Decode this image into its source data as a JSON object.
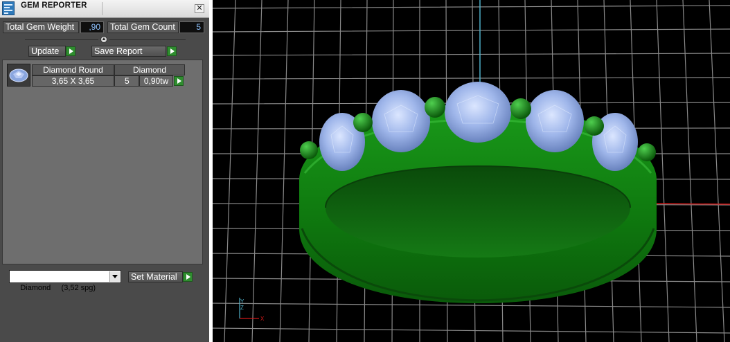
{
  "window": {
    "title": "GEM REPORTER",
    "close_glyph": "✕"
  },
  "summary": {
    "weight_label": "Total Gem Weight",
    "weight_value": ",90",
    "count_label": "Total Gem Count",
    "count_value": "5"
  },
  "actions": {
    "update_label": "Update",
    "save_label": "Save Report"
  },
  "table": {
    "headers": [
      "Diamond Round",
      "Diamond"
    ],
    "row": {
      "size": "3,65 X 3,65",
      "count": "5",
      "weight": "0,90tw"
    }
  },
  "material": {
    "selected": "Diamond     (3,52 spg)",
    "set_label": "Set Material"
  },
  "axis": {
    "y": "Y",
    "z": "Z",
    "x": "X"
  },
  "colors": {
    "ring": "#1e8a1e",
    "gem": "#9cb4e8",
    "grid": "#8a8a8a",
    "axis_red": "#d01818",
    "axis_cyan": "#4fb0c8"
  },
  "icons": [
    "app-icon",
    "close-icon",
    "collapse-arrow-icon",
    "play-arrow-icon",
    "gem-icon",
    "dropdown-arrow-icon"
  ]
}
